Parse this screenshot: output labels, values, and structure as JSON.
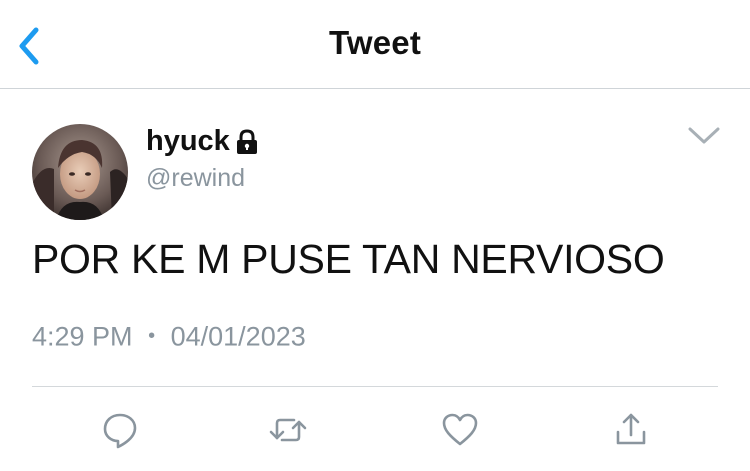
{
  "header": {
    "title": "Tweet",
    "back_icon": "chevron-left-icon"
  },
  "author": {
    "display_name": "hyuck",
    "handle": "@rewind",
    "protected_icon": "lock-icon",
    "avatar": "avatar-photo"
  },
  "tweet": {
    "text": "POR KE M PUSE TAN NERVIOSO",
    "time": "4:29 PM",
    "separator": "•",
    "date": "04/01/2023",
    "menu_icon": "chevron-down-icon"
  },
  "actions": [
    {
      "icon": "reply-icon"
    },
    {
      "icon": "retweet-icon"
    },
    {
      "icon": "like-icon"
    },
    {
      "icon": "share-icon"
    }
  ],
  "colors": {
    "accent": "#1d9bf0",
    "text": "#111111",
    "muted": "#8a959e",
    "icon_gray": "#8a959e"
  }
}
